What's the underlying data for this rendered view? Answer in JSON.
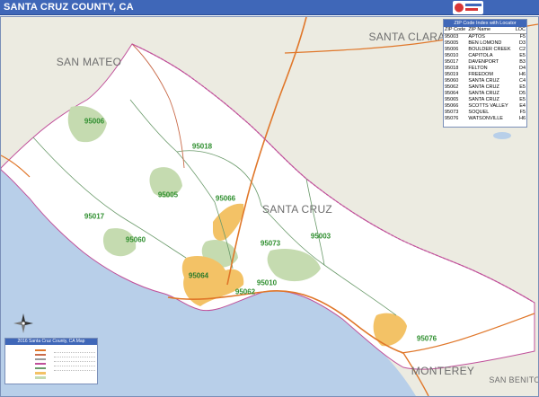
{
  "title": "SANTA CRUZ COUNTY, CA",
  "brand": {
    "logo_icon": "marketmaps-logo-icon"
  },
  "colors": {
    "title_bar": "#3f67b8",
    "ocean": "#b8cfe9",
    "county_land": "#ffffff",
    "outside_land": "#ecebe1",
    "parks": "#c5dbb0",
    "city": "#f3c266",
    "zip_label": "#2f8f2f",
    "highway": "#e0772a",
    "county_boundary": "#c0509a",
    "zip_boundary": "#6a9a6a"
  },
  "regions": {
    "san_mateo": "SAN MATEO",
    "santa_clara": "SANTA CLARA",
    "santa_cruz": "SANTA CRUZ",
    "monterey": "MONTEREY",
    "san_benito": "SAN BENITO"
  },
  "zip_labels": [
    "95006",
    "95018",
    "95005",
    "95066",
    "95017",
    "95060",
    "95073",
    "95003",
    "95064",
    "95062",
    "95010",
    "95076"
  ],
  "zip_table": {
    "title": "ZIP Code Index with Locator",
    "headers": [
      "ZIP Code",
      "ZIP Name",
      "LOC"
    ],
    "rows": [
      [
        "95003",
        "APTOS",
        "F5"
      ],
      [
        "95005",
        "BEN LOMOND",
        "D3"
      ],
      [
        "95006",
        "BOULDER CREEK",
        "C2"
      ],
      [
        "95010",
        "CAPITOLA",
        "E5"
      ],
      [
        "95017",
        "DAVENPORT",
        "B3"
      ],
      [
        "95018",
        "FELTON",
        "D4"
      ],
      [
        "95019",
        "FREEDOM",
        "H6"
      ],
      [
        "95060",
        "SANTA CRUZ",
        "C4"
      ],
      [
        "95062",
        "SANTA CRUZ",
        "E5"
      ],
      [
        "95064",
        "SANTA CRUZ",
        "D5"
      ],
      [
        "95065",
        "SANTA CRUZ",
        "E5"
      ],
      [
        "95066",
        "SCOTTS VALLEY",
        "E4"
      ],
      [
        "95073",
        "SOQUEL",
        "F5"
      ],
      [
        "95076",
        "WATSONVILLE",
        "H6"
      ]
    ]
  },
  "legend": {
    "title": "2016 Santa Cruz County, CA Map"
  },
  "compass_icon": "compass-rose-icon"
}
